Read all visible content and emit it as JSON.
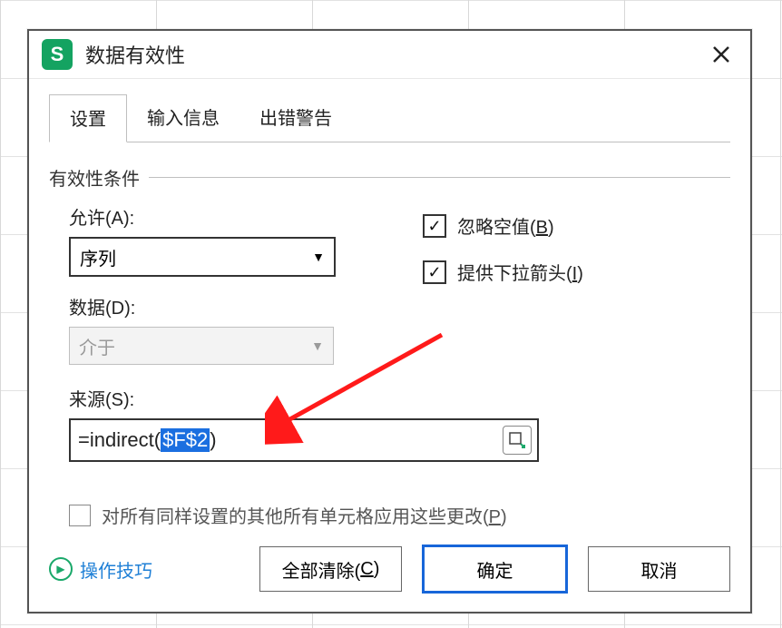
{
  "dialog": {
    "title": "数据有效性",
    "close_aria": "关闭"
  },
  "tabs": {
    "settings": "设置",
    "input_msg": "输入信息",
    "error_alert": "出错警告"
  },
  "section": {
    "criteria": "有效性条件"
  },
  "allow": {
    "label": "允许(A):",
    "value": "序列"
  },
  "data": {
    "label": "数据(D):",
    "value": "介于"
  },
  "ignore_blank": {
    "label": "忽略空值(B)"
  },
  "dropdown": {
    "label": "提供下拉箭头(I)"
  },
  "source": {
    "label": "来源(S):",
    "prefix": "=indirect(",
    "selected": "$F$2",
    "suffix": ")"
  },
  "apply_all": {
    "label": "对所有同样设置的其他所有单元格应用这些更改(P)"
  },
  "footer": {
    "tips": "操作技巧",
    "clear_all": "全部清除(C)",
    "ok": "确定",
    "cancel": "取消"
  }
}
